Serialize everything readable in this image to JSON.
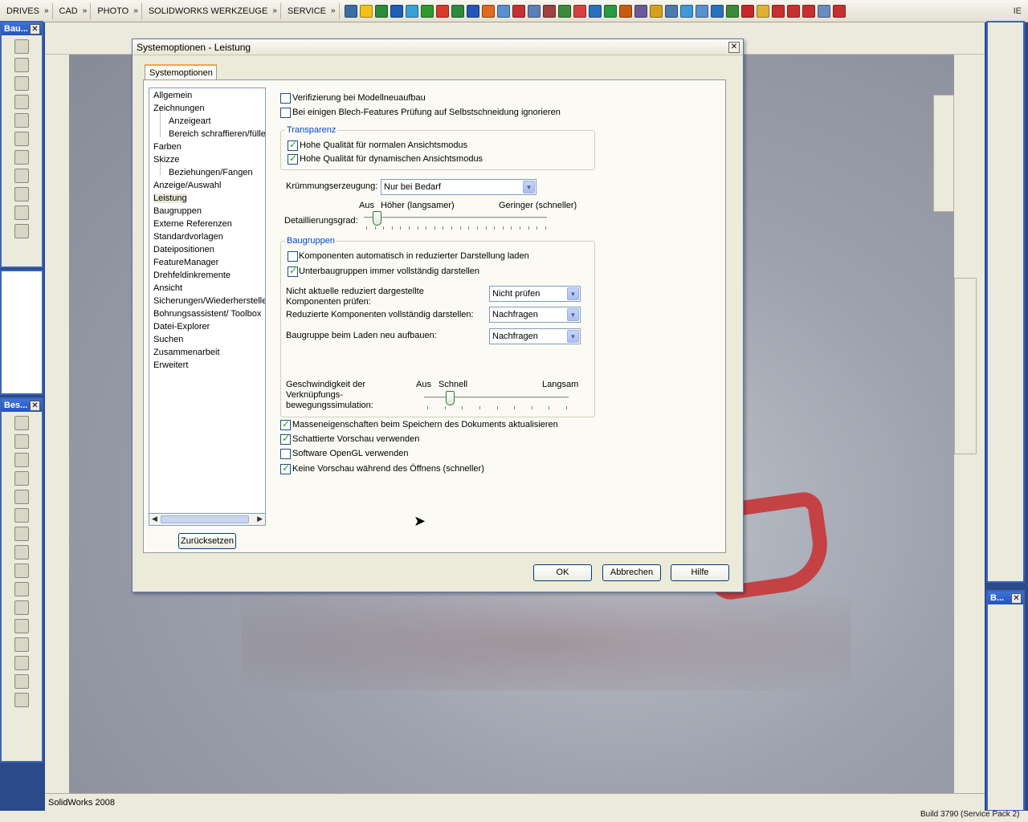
{
  "topbar": {
    "menus": [
      "DRIVES",
      "CAD",
      "PHOTO",
      "SOLIDWORKS WERKZEUGE",
      "SERVICE"
    ],
    "right_label": "IE",
    "icon_colors": [
      "#3a6ea5",
      "#f2c21b",
      "#2e8b3a",
      "#1d5fb8",
      "#3aa0d8",
      "#2d9a2d",
      "#d83a2a",
      "#2b8a3e",
      "#2456b8",
      "#e06a20",
      "#5a8fd0",
      "#c63030",
      "#5c7fb8",
      "#a04040",
      "#3c8a3c",
      "#d84040",
      "#2a70c0",
      "#2a9a40",
      "#c85a10",
      "#6a5a9a",
      "#d8a020",
      "#4a7ab0",
      "#3c9ad8",
      "#5a8fd0",
      "#2a70c0",
      "#3a8a3a",
      "#c82828",
      "#e0b030",
      "#c83030",
      "#c83030",
      "#c83030",
      "#6a8ac0",
      "#c83030"
    ]
  },
  "dialog": {
    "title": "Systemoptionen - Leistung",
    "tab_label": "Systemoptionen",
    "tree": {
      "items": [
        {
          "label": "Allgemein",
          "level": 0
        },
        {
          "label": "Zeichnungen",
          "level": 0
        },
        {
          "label": "Anzeigeart",
          "level": 1
        },
        {
          "label": "Bereich schraffieren/füllen",
          "level": 1
        },
        {
          "label": "Farben",
          "level": 0
        },
        {
          "label": "Skizze",
          "level": 0
        },
        {
          "label": "Beziehungen/Fangen",
          "level": 1
        },
        {
          "label": "Anzeige/Auswahl",
          "level": 0
        },
        {
          "label": "Leistung",
          "level": 0,
          "selected": true
        },
        {
          "label": "Baugruppen",
          "level": 0
        },
        {
          "label": "Externe Referenzen",
          "level": 0
        },
        {
          "label": "Standardvorlagen",
          "level": 0
        },
        {
          "label": "Dateipositionen",
          "level": 0
        },
        {
          "label": "FeatureManager",
          "level": 0
        },
        {
          "label": "Drehfeldinkremente",
          "level": 0
        },
        {
          "label": "Ansicht",
          "level": 0
        },
        {
          "label": "Sicherungen/Wiederherstellen",
          "level": 0
        },
        {
          "label": "Bohrungsassistent/ Toolbox",
          "level": 0
        },
        {
          "label": "Datei-Explorer",
          "level": 0
        },
        {
          "label": "Suchen",
          "level": 0
        },
        {
          "label": "Zusammenarbeit",
          "level": 0
        },
        {
          "label": "Erweitert",
          "level": 0
        }
      ]
    },
    "reset_button": "Zurücksetzen",
    "options": {
      "verify_rebuild": {
        "label": "Verifizierung bei Modellneuaufbau",
        "checked": false
      },
      "ignore_self_intersection": {
        "label": "Bei einigen Blech-Features Prüfung auf Selbstschneidung ignorieren",
        "checked": false
      }
    },
    "transparency": {
      "title": "Transparenz",
      "hq_normal": {
        "label": "Hohe Qualität für normalen Ansichtsmodus",
        "checked": true
      },
      "hq_dynamic": {
        "label": "Hohe Qualität für dynamischen Ansichtsmodus",
        "checked": true
      }
    },
    "curvature": {
      "label": "Krümmungserzeugung:",
      "value": "Nur bei Bedarf"
    },
    "detail": {
      "label": "Detaillierungsgrad:",
      "left_label": "Aus",
      "mid_label": "Höher (langsamer)",
      "right_label": "Geringer (schneller)",
      "level": 0.07
    },
    "assemblies": {
      "title": "Baugruppen",
      "auto_lightweight": {
        "label": "Komponenten automatisch in reduzierter Darstellung laden",
        "checked": false
      },
      "always_resolve_sub": {
        "label": "Unterbaugruppen immer vollständig darstellen",
        "checked": true
      },
      "check_stale_label_1": "Nicht aktuelle reduziert dargestellte",
      "check_stale_label_2": "Komponenten prüfen:",
      "check_stale_value": "Nicht prüfen",
      "resolve_label": "Reduzierte Komponenten vollständig darstellen:",
      "resolve_value": "Nachfragen",
      "rebuild_label": "Baugruppe beim Laden neu aufbauen:",
      "rebuild_value": "Nachfragen",
      "speed_label_1": "Geschwindigkeit der",
      "speed_label_2": "Verknüpfungs-",
      "speed_label_3": "bewegungssimulation:",
      "speed_off": "Aus",
      "speed_fast": "Schnell",
      "speed_slow": "Langsam",
      "speed_level": 0.18
    },
    "bottom_options": {
      "mass_props": {
        "label": "Masseneigenschaften beim Speichern des Dokuments aktualisieren",
        "checked": true
      },
      "shaded_preview": {
        "label": "Schattierte Vorschau verwenden",
        "checked": true
      },
      "software_opengl": {
        "label": "Software OpenGL verwenden",
        "checked": false
      },
      "no_preview": {
        "label": "Keine Vorschau während des Öffnens (schneller)",
        "checked": true
      }
    },
    "buttons": {
      "ok": "OK",
      "cancel": "Abbrechen",
      "help": "Hilfe"
    }
  },
  "left_panels": {
    "panel1_title": "Bau...",
    "panel2_title": "Bes..."
  },
  "right_panel": {
    "title": "B..."
  },
  "status": {
    "app": "SolidWorks 2008",
    "build": "Build 3790 (Service Pack 2)"
  }
}
